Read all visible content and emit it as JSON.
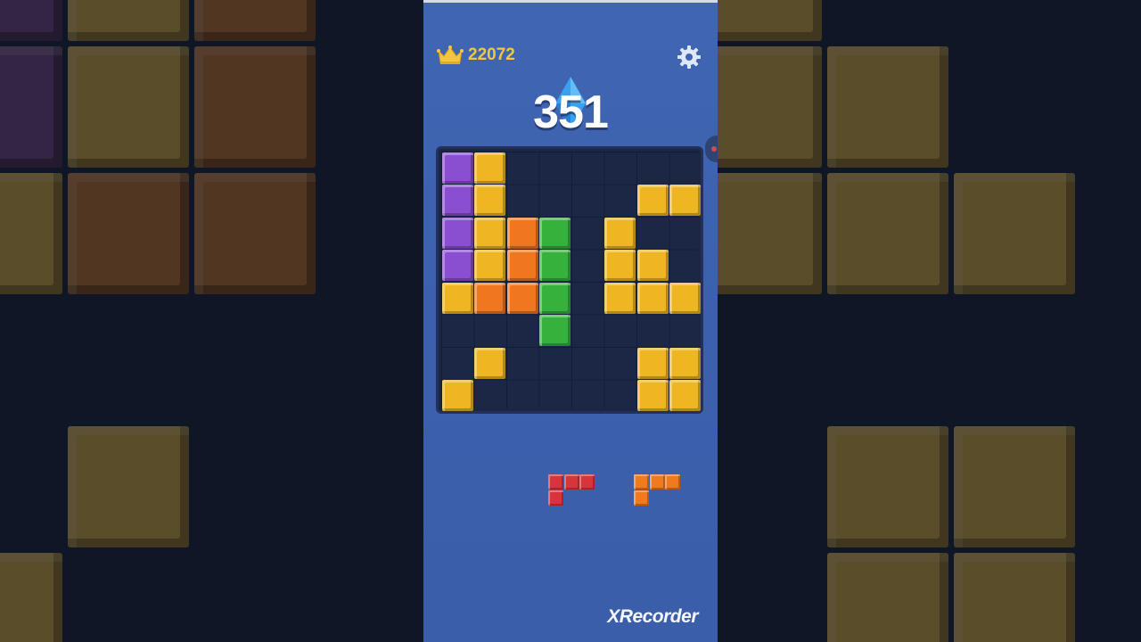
{
  "hud": {
    "best_score": "22072",
    "score": "351"
  },
  "colors": {
    "purple": "#8a4fd1",
    "yellow": "#eeb622",
    "orange": "#ee7720",
    "green": "#36b23c",
    "red": "#d8343c",
    "piece_orange": "#f07a1e"
  },
  "board": {
    "rows": 8,
    "cols": 8,
    "cells": [
      {
        "r": 0,
        "c": 0,
        "color": "purple"
      },
      {
        "r": 0,
        "c": 1,
        "color": "yellow"
      },
      {
        "r": 1,
        "c": 0,
        "color": "purple"
      },
      {
        "r": 1,
        "c": 1,
        "color": "yellow"
      },
      {
        "r": 1,
        "c": 6,
        "color": "yellow"
      },
      {
        "r": 1,
        "c": 7,
        "color": "yellow"
      },
      {
        "r": 2,
        "c": 0,
        "color": "purple"
      },
      {
        "r": 2,
        "c": 1,
        "color": "yellow"
      },
      {
        "r": 2,
        "c": 2,
        "color": "orange"
      },
      {
        "r": 2,
        "c": 3,
        "color": "green"
      },
      {
        "r": 2,
        "c": 5,
        "color": "yellow"
      },
      {
        "r": 3,
        "c": 0,
        "color": "purple"
      },
      {
        "r": 3,
        "c": 1,
        "color": "yellow"
      },
      {
        "r": 3,
        "c": 2,
        "color": "orange"
      },
      {
        "r": 3,
        "c": 3,
        "color": "green"
      },
      {
        "r": 3,
        "c": 5,
        "color": "yellow"
      },
      {
        "r": 3,
        "c": 6,
        "color": "yellow"
      },
      {
        "r": 4,
        "c": 0,
        "color": "yellow"
      },
      {
        "r": 4,
        "c": 1,
        "color": "orange"
      },
      {
        "r": 4,
        "c": 2,
        "color": "orange"
      },
      {
        "r": 4,
        "c": 3,
        "color": "green"
      },
      {
        "r": 4,
        "c": 5,
        "color": "yellow"
      },
      {
        "r": 4,
        "c": 6,
        "color": "yellow"
      },
      {
        "r": 4,
        "c": 7,
        "color": "yellow"
      },
      {
        "r": 5,
        "c": 3,
        "color": "green"
      },
      {
        "r": 6,
        "c": 1,
        "color": "yellow"
      },
      {
        "r": 6,
        "c": 6,
        "color": "yellow"
      },
      {
        "r": 6,
        "c": 7,
        "color": "yellow"
      },
      {
        "r": 7,
        "c": 0,
        "color": "yellow"
      },
      {
        "r": 7,
        "c": 6,
        "color": "yellow"
      },
      {
        "r": 7,
        "c": 7,
        "color": "yellow"
      }
    ]
  },
  "pieces": [
    {
      "name": "piece-red-l",
      "color": "red",
      "cells": [
        [
          0,
          0
        ],
        [
          0,
          1
        ],
        [
          0,
          2
        ],
        [
          1,
          0
        ]
      ]
    },
    {
      "name": "piece-orange-l",
      "color": "piece_orange",
      "cells": [
        [
          0,
          0
        ],
        [
          0,
          1
        ],
        [
          0,
          2
        ],
        [
          1,
          0
        ]
      ]
    }
  ],
  "background": {
    "cells": [
      {
        "r": 0,
        "c": 0,
        "color": "purple"
      },
      {
        "r": 0,
        "c": 1,
        "color": "yellow"
      },
      {
        "r": 0,
        "c": 2,
        "color": "orange"
      },
      {
        "r": 0,
        "c": 6,
        "color": "yellow"
      },
      {
        "r": 1,
        "c": 0,
        "color": "purple"
      },
      {
        "r": 1,
        "c": 1,
        "color": "yellow"
      },
      {
        "r": 1,
        "c": 2,
        "color": "orange"
      },
      {
        "r": 1,
        "c": 6,
        "color": "yellow"
      },
      {
        "r": 1,
        "c": 7,
        "color": "yellow"
      },
      {
        "r": 2,
        "c": 0,
        "color": "yellow"
      },
      {
        "r": 2,
        "c": 1,
        "color": "orange"
      },
      {
        "r": 2,
        "c": 2,
        "color": "orange"
      },
      {
        "r": 2,
        "c": 6,
        "color": "yellow"
      },
      {
        "r": 2,
        "c": 7,
        "color": "yellow"
      },
      {
        "r": 2,
        "c": 8,
        "color": "yellow"
      },
      {
        "r": 4,
        "c": 1,
        "color": "yellow"
      },
      {
        "r": 4,
        "c": 7,
        "color": "yellow"
      },
      {
        "r": 4,
        "c": 8,
        "color": "yellow"
      },
      {
        "r": 5,
        "c": 0,
        "color": "yellow"
      },
      {
        "r": 5,
        "c": 7,
        "color": "yellow"
      },
      {
        "r": 5,
        "c": 8,
        "color": "yellow"
      }
    ]
  },
  "watermark": "XRecorder",
  "icons": {
    "crown": "crown-icon",
    "settings": "gear-icon",
    "gem": "diamond-icon"
  }
}
